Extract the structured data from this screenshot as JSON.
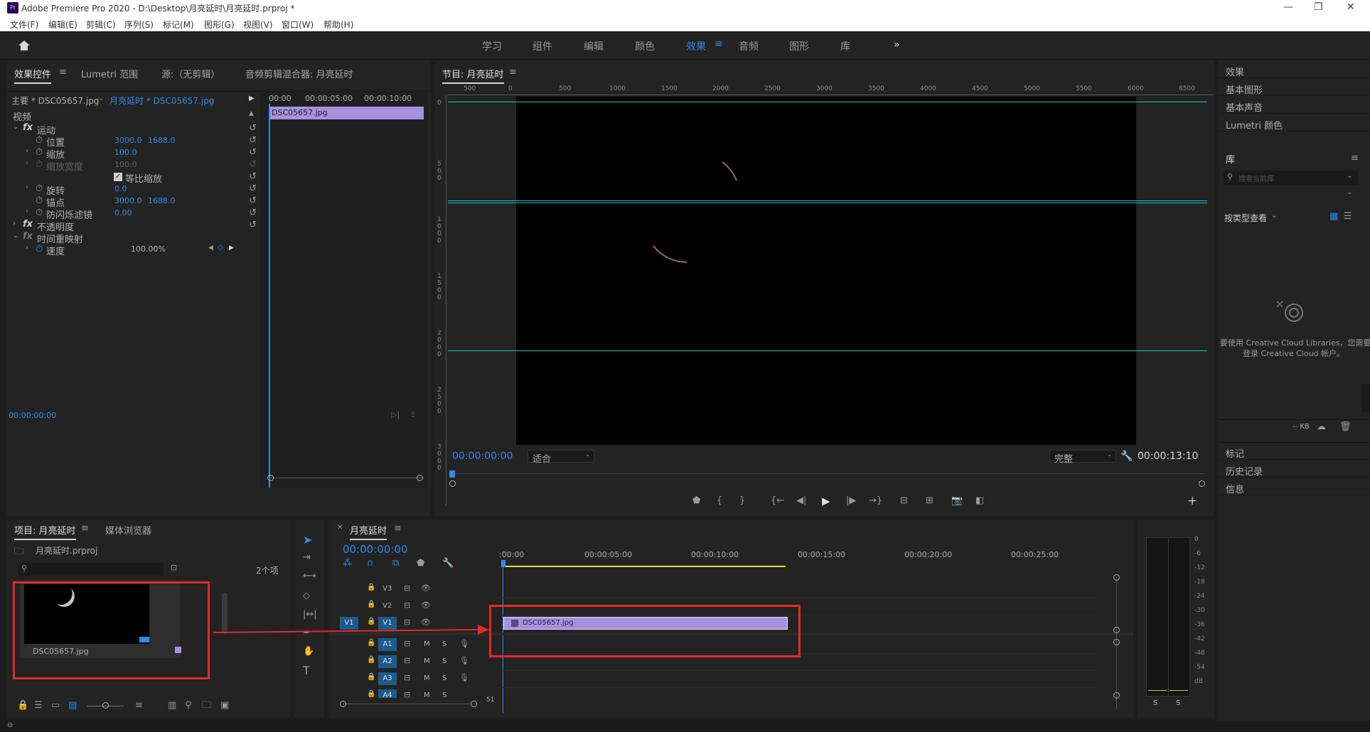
{
  "app": {
    "title": "Adobe Premiere Pro 2020 - D:\\Desktop\\月亮延时\\月亮延时.prproj *",
    "logo": "Pr"
  },
  "menu": [
    "文件(F)",
    "编辑(E)",
    "剪辑(C)",
    "序列(S)",
    "标记(M)",
    "图形(G)",
    "视图(V)",
    "窗口(W)",
    "帮助(H)"
  ],
  "workspaces": [
    "学习",
    "组件",
    "编辑",
    "颜色",
    "效果",
    "音频",
    "图形",
    "库"
  ],
  "active_workspace": "效果",
  "effect_controls": {
    "tabs": [
      "效果控件",
      "Lumetri 范围",
      "源:（无剪辑）",
      "音频剪辑混合器: 月亮延时"
    ],
    "master": "主要 * DSC05657.jpg",
    "clip": "月亮延时 * DSC05657.jpg",
    "ruler": [
      "00:00",
      "00:00:05:00",
      "00:00:10:00"
    ],
    "clip_bar": "DSC05657.jpg",
    "section": "视频",
    "rows": [
      {
        "label": "运动",
        "fx": "fx",
        "v1": "",
        "v2": ""
      },
      {
        "label": "位置",
        "v1": "3000.0",
        "v2": "1688.0"
      },
      {
        "label": "缩放",
        "v1": "100.0",
        "v2": ""
      },
      {
        "label": "缩放宽度",
        "v1": "100.0",
        "v2": ""
      },
      {
        "label": "等比缩放",
        "v1": "",
        "v2": ""
      },
      {
        "label": "旋转",
        "v1": "0.0",
        "v2": ""
      },
      {
        "label": "锚点",
        "v1": "3000.0",
        "v2": "1688.0"
      },
      {
        "label": "防闪烁滤镜",
        "v1": "0.00",
        "v2": ""
      },
      {
        "label": "不透明度",
        "fx": "fx",
        "v1": "",
        "v2": ""
      },
      {
        "label": "时间重映射",
        "fx": "fx",
        "v1": "",
        "v2": ""
      },
      {
        "label": "速度",
        "v1": "100.00%",
        "v2": ""
      }
    ],
    "timecode": "00:00:00:00"
  },
  "program": {
    "title": "节目: 月亮延时",
    "ruler": [
      "500",
      "0",
      "500",
      "1000",
      "1500",
      "2000",
      "2500",
      "3000",
      "3500",
      "4000",
      "4500",
      "5000",
      "5500",
      "6000",
      "6500"
    ],
    "vruler": [
      "0",
      "500",
      "1000",
      "1500",
      "2000",
      "2500",
      "3000"
    ],
    "timecode": "00:00:00:00",
    "fit": "适合",
    "quality": "完整",
    "duration": "00:00:13:10"
  },
  "right_panel": {
    "items": [
      "效果",
      "基本图形",
      "基本声音",
      "Lumetri 颜色"
    ],
    "library": "库",
    "search_placeholder": "搜索当前库",
    "view_by": "按类型查看",
    "cc_msg1": "要使用 Creative Cloud Libraries，您需要",
    "cc_msg2": "登录 Creative Cloud 帐户。",
    "kb": "-- KB",
    "bottom": [
      "标记",
      "历史记录",
      "信息"
    ]
  },
  "project": {
    "tabs": [
      "项目: 月亮延时",
      "媒体浏览器"
    ],
    "file": "月亮延时.prproj",
    "count": "2个项",
    "item": "DSC05657.jpg"
  },
  "timeline": {
    "title": "月亮延时",
    "timecode": "00:00:00:00",
    "ruler": [
      ":00:00",
      "00:00:05:00",
      "00:00:10:00",
      "00:00:15:00",
      "00:00:20:00",
      "00:00:25:00"
    ],
    "vtracks": [
      "V3",
      "V2",
      "V1"
    ],
    "atracks": [
      "A1",
      "A2",
      "A3",
      "A4"
    ],
    "clip": "DSC05657.jpg",
    "src": "V1"
  },
  "meter": {
    "scale": [
      "0",
      "-6",
      "-12",
      "-18",
      "-24",
      "-30",
      "-36",
      "-42",
      "-48",
      "-54",
      "dB"
    ],
    "solo": [
      "S",
      "S"
    ]
  },
  "colors": {
    "accent": "#2d8ceb",
    "clip": "#a790e0",
    "annotation": "#e8272b",
    "guide": "#19c4c4"
  }
}
